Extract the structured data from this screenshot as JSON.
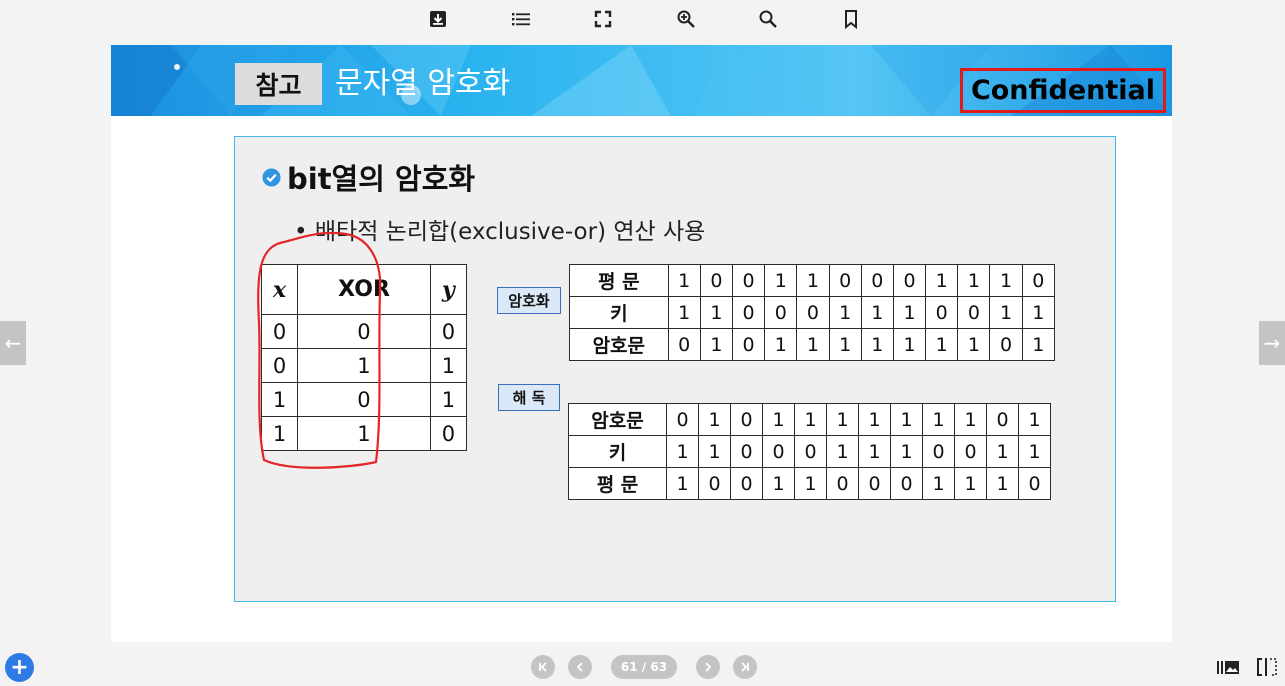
{
  "toolbar": {
    "icons": [
      "download-icon",
      "list-icon",
      "fullscreen-icon",
      "zoom-in-icon",
      "search-icon",
      "bookmark-icon"
    ]
  },
  "slide": {
    "ref_tag": "참고",
    "title": "문자열 암호화",
    "confidential": "Confidential",
    "heading": "bit열의 암호화",
    "bullet": "• 배타적 논리합(exclusive-or) 연산 사용",
    "xor_table": {
      "headers": [
        "x",
        "XOR",
        "y"
      ],
      "rows": [
        [
          "0",
          "0",
          "0"
        ],
        [
          "0",
          "1",
          "1"
        ],
        [
          "1",
          "0",
          "1"
        ],
        [
          "1",
          "1",
          "0"
        ]
      ]
    },
    "encrypt_tag": "암호화",
    "decrypt_tag": "해 독",
    "encrypt_table": [
      {
        "label": "평 문",
        "bits": [
          "1",
          "0",
          "0",
          "1",
          "1",
          "0",
          "0",
          "0",
          "1",
          "1",
          "1",
          "0"
        ]
      },
      {
        "label": "키",
        "bits": [
          "1",
          "1",
          "0",
          "0",
          "0",
          "1",
          "1",
          "1",
          "0",
          "0",
          "1",
          "1"
        ]
      },
      {
        "label": "암호문",
        "bits": [
          "0",
          "1",
          "0",
          "1",
          "1",
          "1",
          "1",
          "1",
          "1",
          "1",
          "0",
          "1"
        ]
      }
    ],
    "decrypt_table": [
      {
        "label": "암호문",
        "bits": [
          "0",
          "1",
          "0",
          "1",
          "1",
          "1",
          "1",
          "1",
          "1",
          "1",
          "0",
          "1"
        ]
      },
      {
        "label": "키",
        "bits": [
          "1",
          "1",
          "0",
          "0",
          "0",
          "1",
          "1",
          "1",
          "0",
          "0",
          "1",
          "1"
        ]
      },
      {
        "label": "평 문",
        "bits": [
          "1",
          "0",
          "0",
          "1",
          "1",
          "0",
          "0",
          "0",
          "1",
          "1",
          "1",
          "0"
        ]
      }
    ]
  },
  "pager": {
    "indicator": "61 / 63"
  },
  "colors": {
    "accent_blue": "#2f7be6",
    "banner_blue": "#1fa9ec",
    "confidential_border": "#e41a1a",
    "content_border": "#45b7e3",
    "annotation_red": "#e4252a"
  }
}
